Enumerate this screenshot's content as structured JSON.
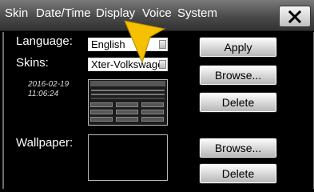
{
  "tabs": [
    {
      "label": "Skin"
    },
    {
      "label": "Date/Time"
    },
    {
      "label": "Display"
    },
    {
      "label": "Voice"
    },
    {
      "label": "System"
    }
  ],
  "close_icon": "close-x-icon",
  "language": {
    "label": "Language:",
    "value": "English"
  },
  "skins": {
    "label": "Skins:",
    "value": "Xter-Volkswage"
  },
  "skin_timestamp": {
    "date": "2016-02-19",
    "time": "11:06:24"
  },
  "wallpaper": {
    "label": "Wallpaper:"
  },
  "buttons": {
    "apply": "Apply",
    "skin_browse": "Browse...",
    "skin_delete": "Delete",
    "wallpaper_browse": "Browse...",
    "wallpaper_delete": "Delete"
  },
  "colors": {
    "cursor": "#f5c000",
    "tabbar": "#555555"
  }
}
